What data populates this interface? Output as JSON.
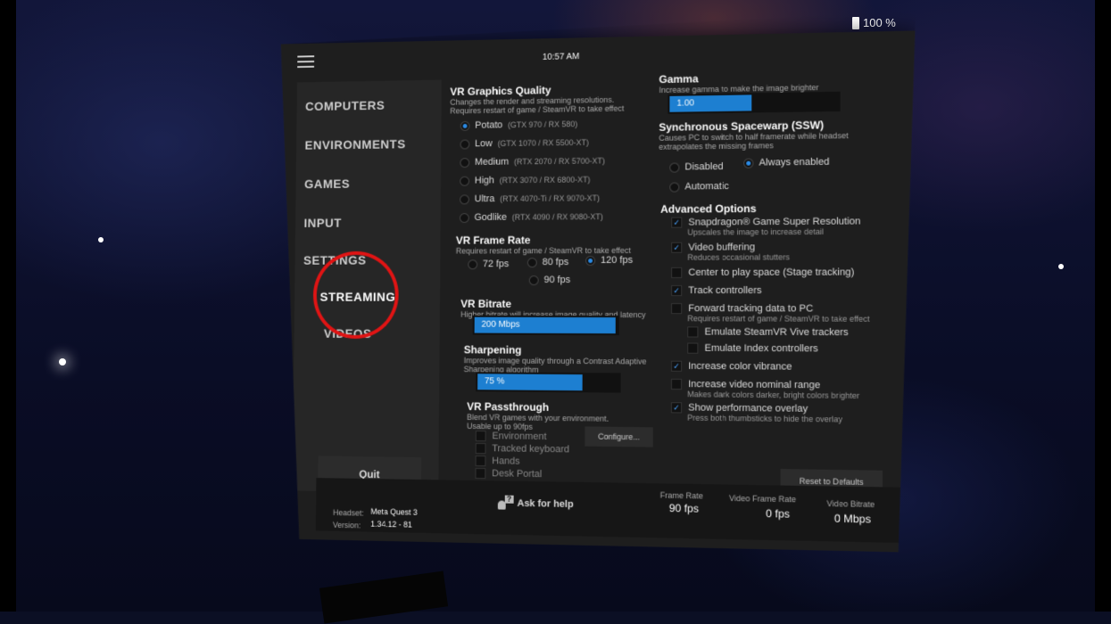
{
  "status": {
    "battery": "100 %",
    "clock": "10:57 AM"
  },
  "sidebar": {
    "items": [
      {
        "label": "COMPUTERS"
      },
      {
        "label": "ENVIRONMENTS"
      },
      {
        "label": "GAMES"
      },
      {
        "label": "INPUT"
      },
      {
        "label": "SETTINGS"
      },
      {
        "label": "STREAMING",
        "active": true
      },
      {
        "label": "VIDEOS"
      }
    ],
    "quit_label": "Quit"
  },
  "graphics": {
    "title": "VR Graphics Quality",
    "desc": "Changes the render and streaming resolutions. Requires restart of game / SteamVR to take effect",
    "options": [
      {
        "label": "Potato",
        "hint": "(GTX 970 / RX 580)",
        "selected": true
      },
      {
        "label": "Low",
        "hint": "(GTX 1070 / RX 5500-XT)",
        "selected": false
      },
      {
        "label": "Medium",
        "hint": "(RTX 2070 / RX 5700-XT)",
        "selected": false
      },
      {
        "label": "High",
        "hint": "(RTX 3070 / RX 6800-XT)",
        "selected": false
      },
      {
        "label": "Ultra",
        "hint": "(RTX 4070-Ti / RX 9070-XT)",
        "selected": false
      },
      {
        "label": "Godlike",
        "hint": "(RTX 4090 / RX 9080-XT)",
        "selected": false
      }
    ]
  },
  "framerate": {
    "title": "VR Frame Rate",
    "desc": "Requires restart of game / SteamVR to take effect",
    "options": [
      {
        "label": "72 fps",
        "selected": false
      },
      {
        "label": "80 fps",
        "selected": false
      },
      {
        "label": "120 fps",
        "selected": true
      },
      {
        "label": "90 fps",
        "selected": false
      }
    ]
  },
  "bitrate": {
    "title": "VR Bitrate",
    "desc": "Higher bitrate will increase image quality and latency",
    "value": "200 Mbps",
    "fraction": 0.99
  },
  "sharpening": {
    "title": "Sharpening",
    "desc": "Improves image quality through a Contrast Adaptive Sharpening algorithm",
    "value": "75 %",
    "fraction": 0.75
  },
  "passthrough": {
    "title": "VR Passthrough",
    "desc": "Blend VR games with your environment. Usable up to 90fps",
    "items": [
      "Environment",
      "Tracked keyboard",
      "Hands",
      "Desk Portal"
    ],
    "configure_label": "Configure..."
  },
  "gamma": {
    "title": "Gamma",
    "desc": "Increase gamma to make the image brighter",
    "value": "1.00",
    "fraction": 0.5
  },
  "ssw": {
    "title": "Synchronous Spacewarp (SSW)",
    "desc": "Causes PC to switch to half framerate while headset extrapolates the missing frames",
    "options": [
      {
        "label": "Disabled",
        "selected": false
      },
      {
        "label": "Always enabled",
        "selected": true
      },
      {
        "label": "Automatic",
        "selected": false
      }
    ]
  },
  "advanced": {
    "title": "Advanced Options",
    "items": [
      {
        "label": "Snapdragon® Game Super Resolution",
        "sub": "Upscales the image to increase detail",
        "checked": true
      },
      {
        "label": "Video buffering",
        "sub": "Reduces occasional stutters",
        "checked": true
      },
      {
        "label": "Center to play space (Stage tracking)",
        "sub": "",
        "checked": false
      },
      {
        "label": "Track controllers",
        "sub": "",
        "checked": true
      },
      {
        "label": "Forward tracking data to PC",
        "sub": "Requires restart of game / SteamVR to take effect",
        "checked": false
      },
      {
        "label": "Emulate SteamVR Vive trackers",
        "sub": "",
        "checked": false
      },
      {
        "label": "Emulate Index controllers",
        "sub": "",
        "checked": false
      },
      {
        "label": "Increase color vibrance",
        "sub": "",
        "checked": true
      },
      {
        "label": "Increase video nominal range",
        "sub": "Makes dark colors darker, bright colors brighter",
        "checked": false
      },
      {
        "label": "Show performance overlay",
        "sub": "Press both thumbsticks to hide the overlay",
        "checked": true
      }
    ],
    "reset_label": "Reset to Defaults"
  },
  "footer": {
    "headset_label": "Headset:",
    "headset_value": "Meta Quest 3",
    "version_label": "Version:",
    "version_value": "1.34.12 - 81",
    "help_label": "Ask for help",
    "frame_rate_label": "Frame Rate",
    "frame_rate_value": "90 fps",
    "video_frame_rate_label": "Video Frame Rate",
    "video_frame_rate_value": "0 fps",
    "video_bitrate_label": "Video Bitrate",
    "video_bitrate_value": "0 Mbps"
  },
  "colors": {
    "accent": "#1d7fd1",
    "highlight_ring": "#e01414"
  },
  "icons": [
    "menu-icon",
    "battery-icon",
    "help-icon",
    "checkmark-icon"
  ]
}
